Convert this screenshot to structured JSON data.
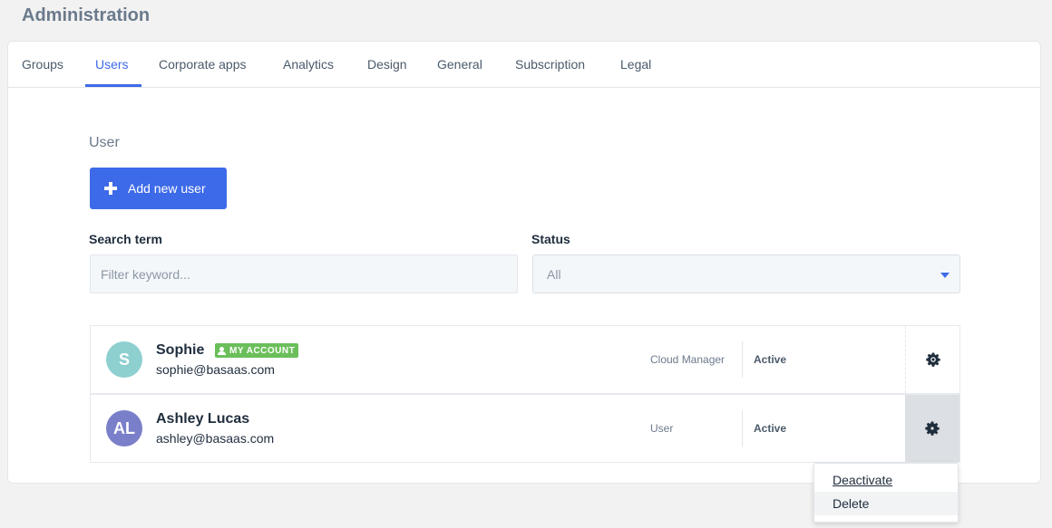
{
  "page": {
    "title": "Administration"
  },
  "tabs": [
    {
      "label": "Groups"
    },
    {
      "label": "Users",
      "active": true
    },
    {
      "label": "Corporate apps"
    },
    {
      "label": "Analytics"
    },
    {
      "label": "Design"
    },
    {
      "label": "General"
    },
    {
      "label": "Subscription"
    },
    {
      "label": "Legal"
    }
  ],
  "section": {
    "title": "User",
    "add_button": "Add new user"
  },
  "filters": {
    "search_label": "Search term",
    "search_placeholder": "Filter keyword...",
    "search_value": "",
    "status_label": "Status",
    "status_value": "All"
  },
  "users": [
    {
      "initials": "S",
      "avatar_color": "#8ecfd0",
      "name": "Sophie",
      "badge": "MY ACCOUNT",
      "email": "sophie@basaas.com",
      "role": "Cloud Manager",
      "status": "Active"
    },
    {
      "initials": "AL",
      "avatar_color": "#7a7fc9",
      "name": "Ashley Lucas",
      "email": "ashley@basaas.com",
      "role": "User",
      "status": "Active"
    }
  ],
  "context_menu": {
    "items": [
      "Deactivate",
      "Delete"
    ]
  },
  "colors": {
    "accent": "#3d6ae8",
    "badge": "#6bbf5a"
  }
}
